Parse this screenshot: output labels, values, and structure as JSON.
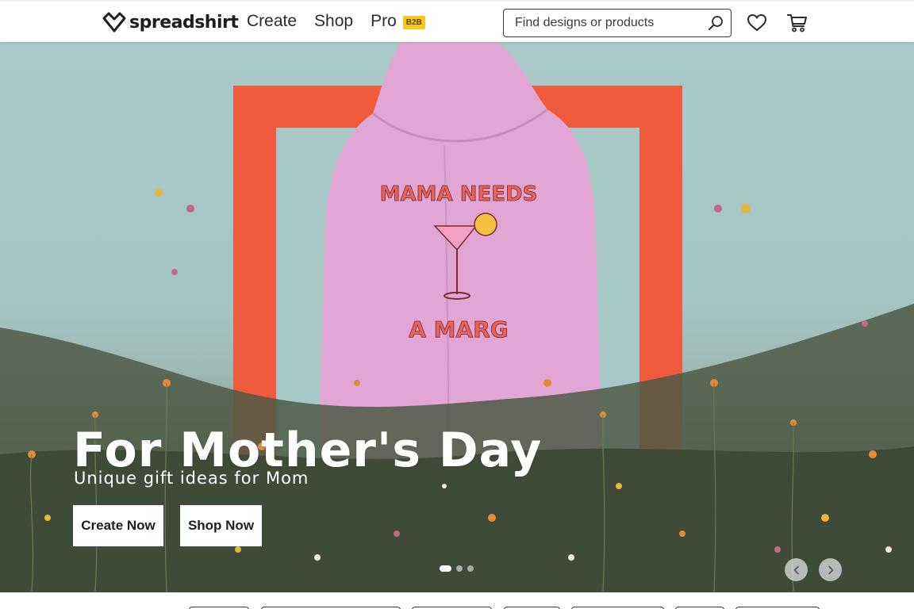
{
  "brand": {
    "name": "spreadshirt"
  },
  "nav": {
    "items": [
      {
        "label": "Create"
      },
      {
        "label": "Shop"
      },
      {
        "label": "Pro"
      }
    ],
    "pro_badge": "B2B"
  },
  "search": {
    "placeholder": "Find designs or products",
    "value": ""
  },
  "icons": {
    "search": "search-icon",
    "wishlist": "heart-icon",
    "cart": "cart-icon"
  },
  "hero": {
    "title": "For Mother's Day",
    "subtitle": "Unique gift ideas for Mom",
    "create_button": "Create Now",
    "shop_button": "Shop Now",
    "print_text_top": "MAMA NEEDS",
    "print_text_bottom": "A MARG",
    "slides": [
      {
        "active": true
      },
      {
        "active": false
      },
      {
        "active": false
      }
    ]
  },
  "colors": {
    "accent_badge": "#f7c71e",
    "frame_red": "#ef5a3c",
    "hoodie_pink": "#e2a6d4",
    "sky": "#a9c9c8"
  }
}
